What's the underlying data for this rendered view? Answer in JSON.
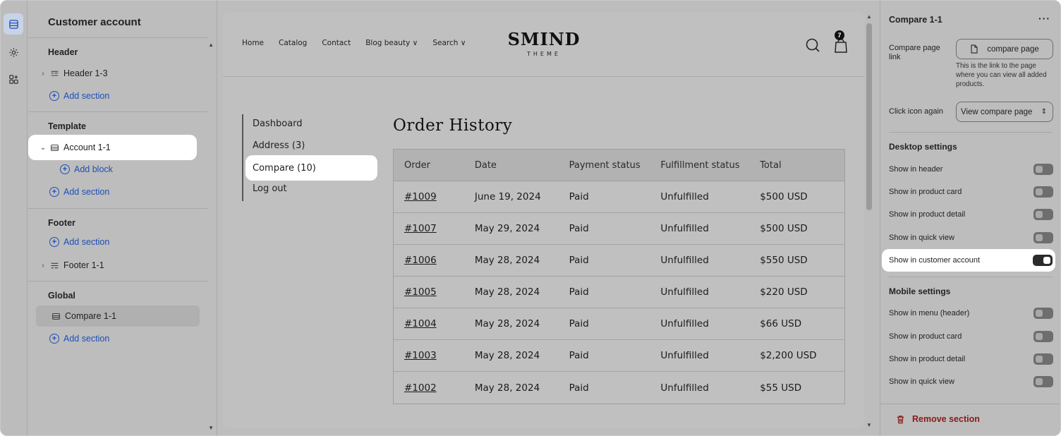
{
  "sidebar": {
    "title": "Customer account",
    "header_group": "Header",
    "header_item": "Header 1-3",
    "add_section": "Add section",
    "template_group": "Template",
    "template_item": "Account 1-1",
    "add_block": "Add block",
    "footer_group": "Footer",
    "footer_item": "Footer 1-1",
    "global_group": "Global",
    "global_item": "Compare 1-1"
  },
  "store": {
    "nav": [
      "Home",
      "Catalog",
      "Contact",
      "Blog beauty ∨",
      "Search ∨"
    ],
    "logo_main": "SMIND",
    "logo_sub": "THEME",
    "cart_count": "7",
    "menu": [
      "Dashboard",
      "Address (3)",
      "Compare (10)",
      "Log out"
    ],
    "orders_title": "Order History",
    "columns": [
      "Order",
      "Date",
      "Payment status",
      "Fulfillment status",
      "Total"
    ],
    "orders": [
      [
        "#1009",
        "June 19, 2024",
        "Paid",
        "Unfulfilled",
        "$500 USD"
      ],
      [
        "#1007",
        "May 29, 2024",
        "Paid",
        "Unfulfilled",
        "$500 USD"
      ],
      [
        "#1006",
        "May 28, 2024",
        "Paid",
        "Unfulfilled",
        "$550 USD"
      ],
      [
        "#1005",
        "May 28, 2024",
        "Paid",
        "Unfulfilled",
        "$220 USD"
      ],
      [
        "#1004",
        "May 28, 2024",
        "Paid",
        "Unfulfilled",
        "$66 USD"
      ],
      [
        "#1003",
        "May 28, 2024",
        "Paid",
        "Unfulfilled",
        "$2,200 USD"
      ],
      [
        "#1002",
        "May 28, 2024",
        "Paid",
        "Unfulfilled",
        "$55 USD"
      ]
    ]
  },
  "panel": {
    "title": "Compare 1-1",
    "more": "···",
    "compare_link_label": "Compare page link",
    "compare_link_value": "compare page",
    "compare_link_help": "This is the link to the page where you can view all added products.",
    "click_icon_label": "Click icon again",
    "click_icon_value": "View compare page",
    "desktop_head": "Desktop settings",
    "desktop_toggles": [
      {
        "label": "Show in header",
        "on": false
      },
      {
        "label": "Show in product card",
        "on": false
      },
      {
        "label": "Show in product detail",
        "on": false
      },
      {
        "label": "Show in quick view",
        "on": false
      },
      {
        "label": "Show in customer account",
        "on": true
      }
    ],
    "mobile_head": "Mobile settings",
    "mobile_toggles": [
      {
        "label": "Show in menu (header)",
        "on": false
      },
      {
        "label": "Show in product card",
        "on": false
      },
      {
        "label": "Show in product detail",
        "on": false
      },
      {
        "label": "Show in quick view",
        "on": false
      }
    ],
    "remove_label": "Remove section"
  },
  "colors": {
    "accent_link": "#1e4fb8",
    "danger": "#8a1a1a",
    "highlight": "#ffffff"
  }
}
